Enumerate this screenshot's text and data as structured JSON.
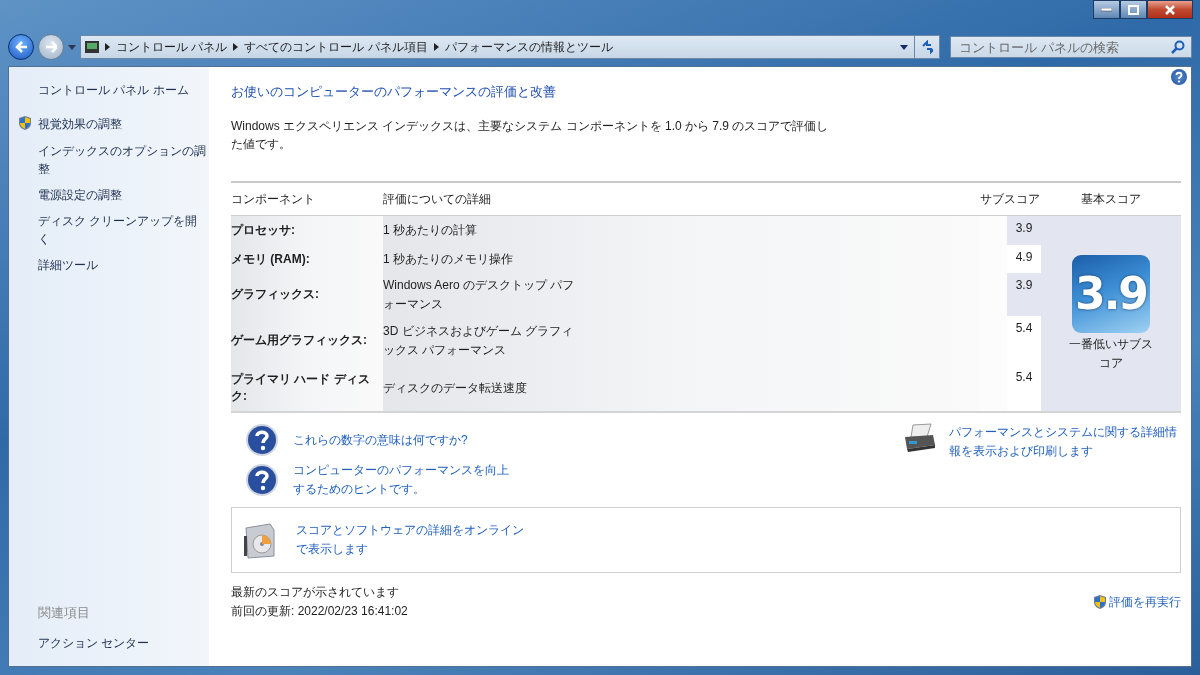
{
  "breadcrumbs": [
    {
      "label": "コントロール パネル"
    },
    {
      "label": "すべてのコントロール パネル項目"
    },
    {
      "label": "パフォーマンスの情報とツール"
    }
  ],
  "search": {
    "placeholder": "コントロール パネルの検索"
  },
  "sidebar": {
    "home": "コントロール パネル ホーム",
    "items": [
      {
        "label": "視覚効果の調整",
        "shield": true
      },
      {
        "label": "インデックスのオプションの調整",
        "shield": false
      },
      {
        "label": "電源設定の調整",
        "shield": false
      },
      {
        "label": "ディスク クリーンアップを開く",
        "shield": false
      },
      {
        "label": "詳細ツール",
        "shield": false
      }
    ],
    "related_heading": "関連項目",
    "related": [
      {
        "label": "アクション センター"
      }
    ]
  },
  "main": {
    "heading": "お使いのコンピューターのパフォーマンスの評価と改善",
    "description": "Windows エクスペリエンス インデックスは、主要なシステム コンポーネントを 1.0 から 7.9 のスコアで評価した値です。",
    "table": {
      "columns": [
        "コンポーネント",
        "評価についての詳細",
        "サブスコア",
        "基本スコア"
      ],
      "rows": [
        {
          "component": "プロセッサ:",
          "detail": "1 秒あたりの計算",
          "subscore": "3.9",
          "lowest": true
        },
        {
          "component": "メモリ (RAM):",
          "detail": "1 秒あたりのメモリ操作",
          "subscore": "4.9",
          "lowest": false
        },
        {
          "component": "グラフィックス:",
          "detail": "Windows Aero のデスクトップ パフォーマンス",
          "subscore": "3.9",
          "lowest": true
        },
        {
          "component": "ゲーム用グラフィックス:",
          "detail": "3D ビジネスおよびゲーム グラフィックス パフォーマンス",
          "subscore": "5.4",
          "lowest": false
        },
        {
          "component": "プライマリ ハード ディスク:",
          "detail": "ディスクのデータ転送速度",
          "subscore": "5.4",
          "lowest": false
        }
      ],
      "base_score": "3.9",
      "base_caption": "一番低いサブスコア"
    },
    "help_links": [
      {
        "label": "これらの数字の意味は何ですか?"
      },
      {
        "label": "コンピューターのパフォーマンスを向上するためのヒントです。"
      }
    ],
    "print_link": "パフォーマンスとシステムに関する詳細情報を表示および印刷します",
    "online_link": "スコアとソフトウェアの詳細をオンラインで表示します",
    "status": "最新のスコアが示されています",
    "last_update": "前回の更新: 2022/02/23 16:41:02",
    "rerun": "評価を再実行"
  }
}
